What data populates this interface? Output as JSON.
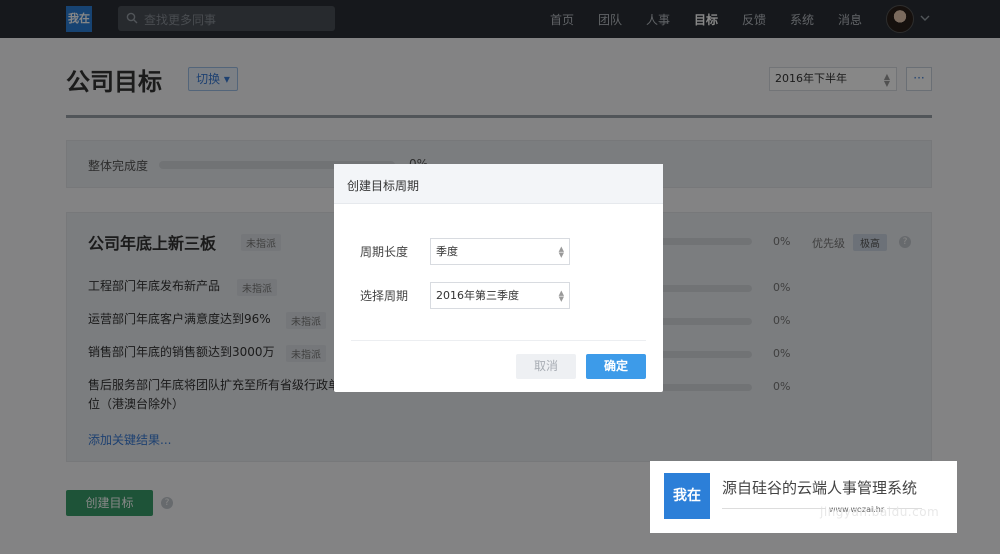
{
  "nav": {
    "logo": "我在",
    "search_placeholder": "查找更多同事",
    "items": [
      {
        "label": "首页",
        "active": false
      },
      {
        "label": "团队",
        "active": false
      },
      {
        "label": "人事",
        "active": false
      },
      {
        "label": "目标",
        "active": true
      },
      {
        "label": "反馈",
        "active": false
      },
      {
        "label": "系统",
        "active": false
      },
      {
        "label": "消息",
        "active": false
      }
    ]
  },
  "header": {
    "title": "公司目标",
    "switch_label": "切换 ▾",
    "period_value": "2016年下半年",
    "more_label": "···"
  },
  "overall": {
    "label": "整体完成度",
    "progress": 0,
    "value_text": "0%"
  },
  "objective": {
    "title": "公司年底上新三板",
    "status": "未指派",
    "progress_text": "0%",
    "priority_label": "优先级",
    "priority_value": "极高",
    "key_results": [
      {
        "text": "工程部门年底发布新产品",
        "status": "未指派",
        "progress_text": "0%"
      },
      {
        "text": "运营部门年底客户满意度达到96%",
        "status": "未指派",
        "progress_text": "0%"
      },
      {
        "text": "销售部门年底的销售额达到3000万",
        "status": "未指派",
        "progress_text": "0%"
      },
      {
        "text": "售后服务部门年底将团队扩充至所有省级行政单位（港澳台除外）",
        "line1": "售后服务部门年底将团队扩充至所有省级行政单",
        "line2": "位（港澳台除外）",
        "status": "",
        "progress_text": "0%"
      }
    ],
    "add_kr_label": "添加关键结果..."
  },
  "footer": {
    "create_label": "创建目标",
    "help": "?"
  },
  "modal": {
    "title": "创建目标周期",
    "length_label": "周期长度",
    "length_value": "季度",
    "period_label": "选择周期",
    "period_value": "2016年第三季度",
    "cancel_label": "取消",
    "ok_label": "确定"
  },
  "watermark": {
    "logo": "我在",
    "text": "源自硅谷的云端人事管理系统",
    "url": "www.wozai.hr",
    "baidu": "jingyan.baidu.com"
  },
  "colors": {
    "nav_bg": "#2a2f35",
    "accent_blue": "#3d9be9",
    "create_green": "#3a9e6a",
    "logo_blue": "#2c7fd8"
  }
}
